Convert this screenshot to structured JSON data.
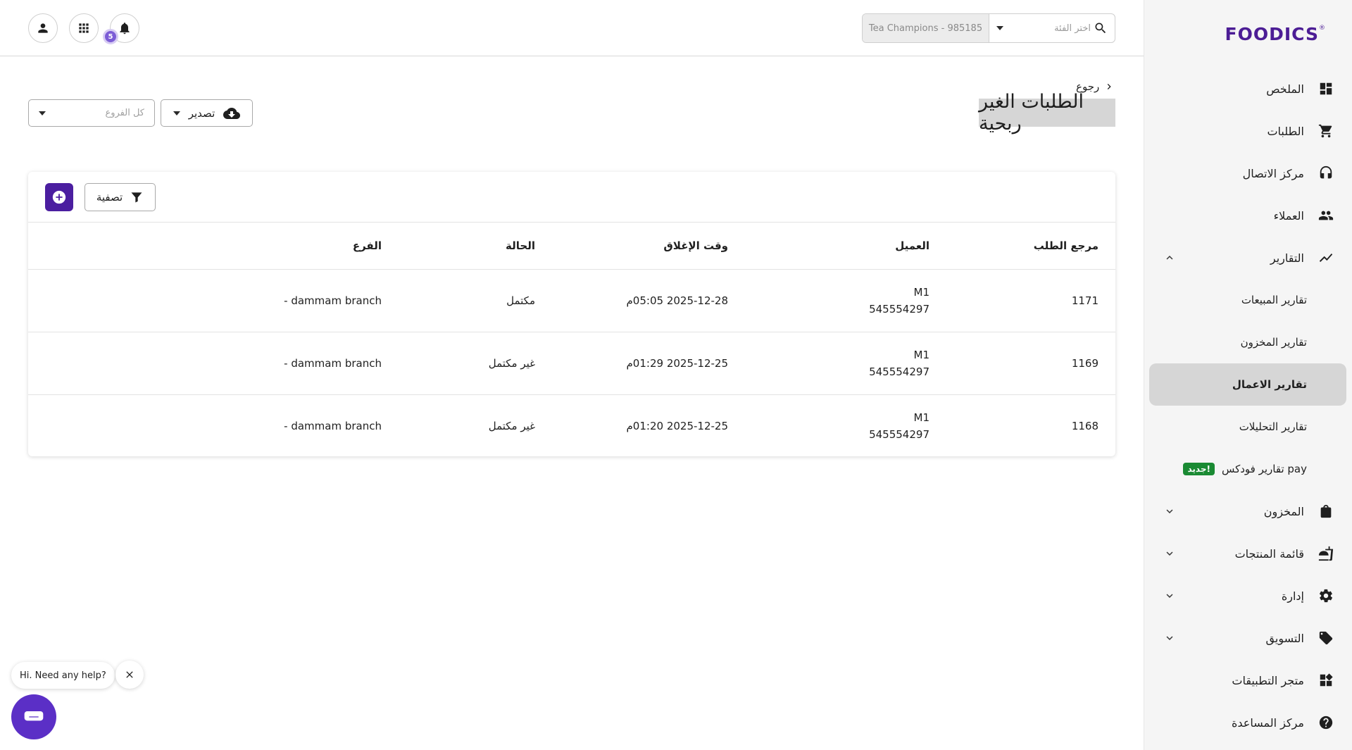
{
  "brand": {
    "logo": "FOODICS",
    "logo_mark": "®"
  },
  "header": {
    "category_placeholder": "اختر الفئة",
    "branch_value": "Tea Champions - 985185",
    "notification_count": "5"
  },
  "sidebar": {
    "items": [
      {
        "label": "الملخص",
        "icon": "dashboard-icon"
      },
      {
        "label": "الطلبات",
        "icon": "cart-icon"
      },
      {
        "label": "مركز الاتصال",
        "icon": "headset-icon"
      },
      {
        "label": "العملاء",
        "icon": "people-icon"
      },
      {
        "label": "التقارير",
        "icon": "trend-icon"
      }
    ],
    "report_subitems": [
      {
        "label": "تقارير المبيعات"
      },
      {
        "label": "تقارير المخزون"
      },
      {
        "label": "تقارير الاعمال"
      },
      {
        "label": "تقارير التحليلات"
      },
      {
        "label": "تقارير فودكس pay",
        "badge": "جديد!"
      }
    ],
    "bottom_items": [
      {
        "label": "المخزون",
        "icon": "bag-icon"
      },
      {
        "label": "قائمة المنتجات",
        "icon": "menu-icon"
      },
      {
        "label": "إدارة",
        "icon": "gear-icon"
      },
      {
        "label": "التسويق",
        "icon": "tag-icon"
      },
      {
        "label": "متجر التطبيقات",
        "icon": "apps-icon"
      },
      {
        "label": "مركز المساعدة",
        "icon": "help-icon"
      }
    ]
  },
  "page": {
    "back_label": "رجوع",
    "title": "الطلبات الغير ربحية",
    "export_label": "تصدير",
    "branches_placeholder": "كل الفروع",
    "filter_label": "تصفية"
  },
  "table": {
    "headers": [
      "مرجع الطلب",
      "العميل",
      "وقت الإغلاق",
      "الحالة",
      "الفرع"
    ],
    "rows": [
      {
        "ref": "1171",
        "customer_name": "M1",
        "customer_phone": "545554297",
        "closed_at": "2025-12-28 05:05م",
        "status": "مكتمل",
        "branch": "dammam branch -"
      },
      {
        "ref": "1169",
        "customer_name": "M1",
        "customer_phone": "545554297",
        "closed_at": "2025-12-25 01:29م",
        "status": "غير مكتمل",
        "branch": "dammam branch -"
      },
      {
        "ref": "1168",
        "customer_name": "M1",
        "customer_phone": "545554297",
        "closed_at": "2025-12-25 01:20م",
        "status": "غير مكتمل",
        "branch": "dammam branch -"
      }
    ]
  },
  "help": {
    "bubble_text": "Hi. Need any help?"
  },
  "colors": {
    "brand": "#4c1d95",
    "primary_button": "#4b1ea0",
    "chat": "#5b2fc6",
    "new_badge": "#1a8a33"
  }
}
